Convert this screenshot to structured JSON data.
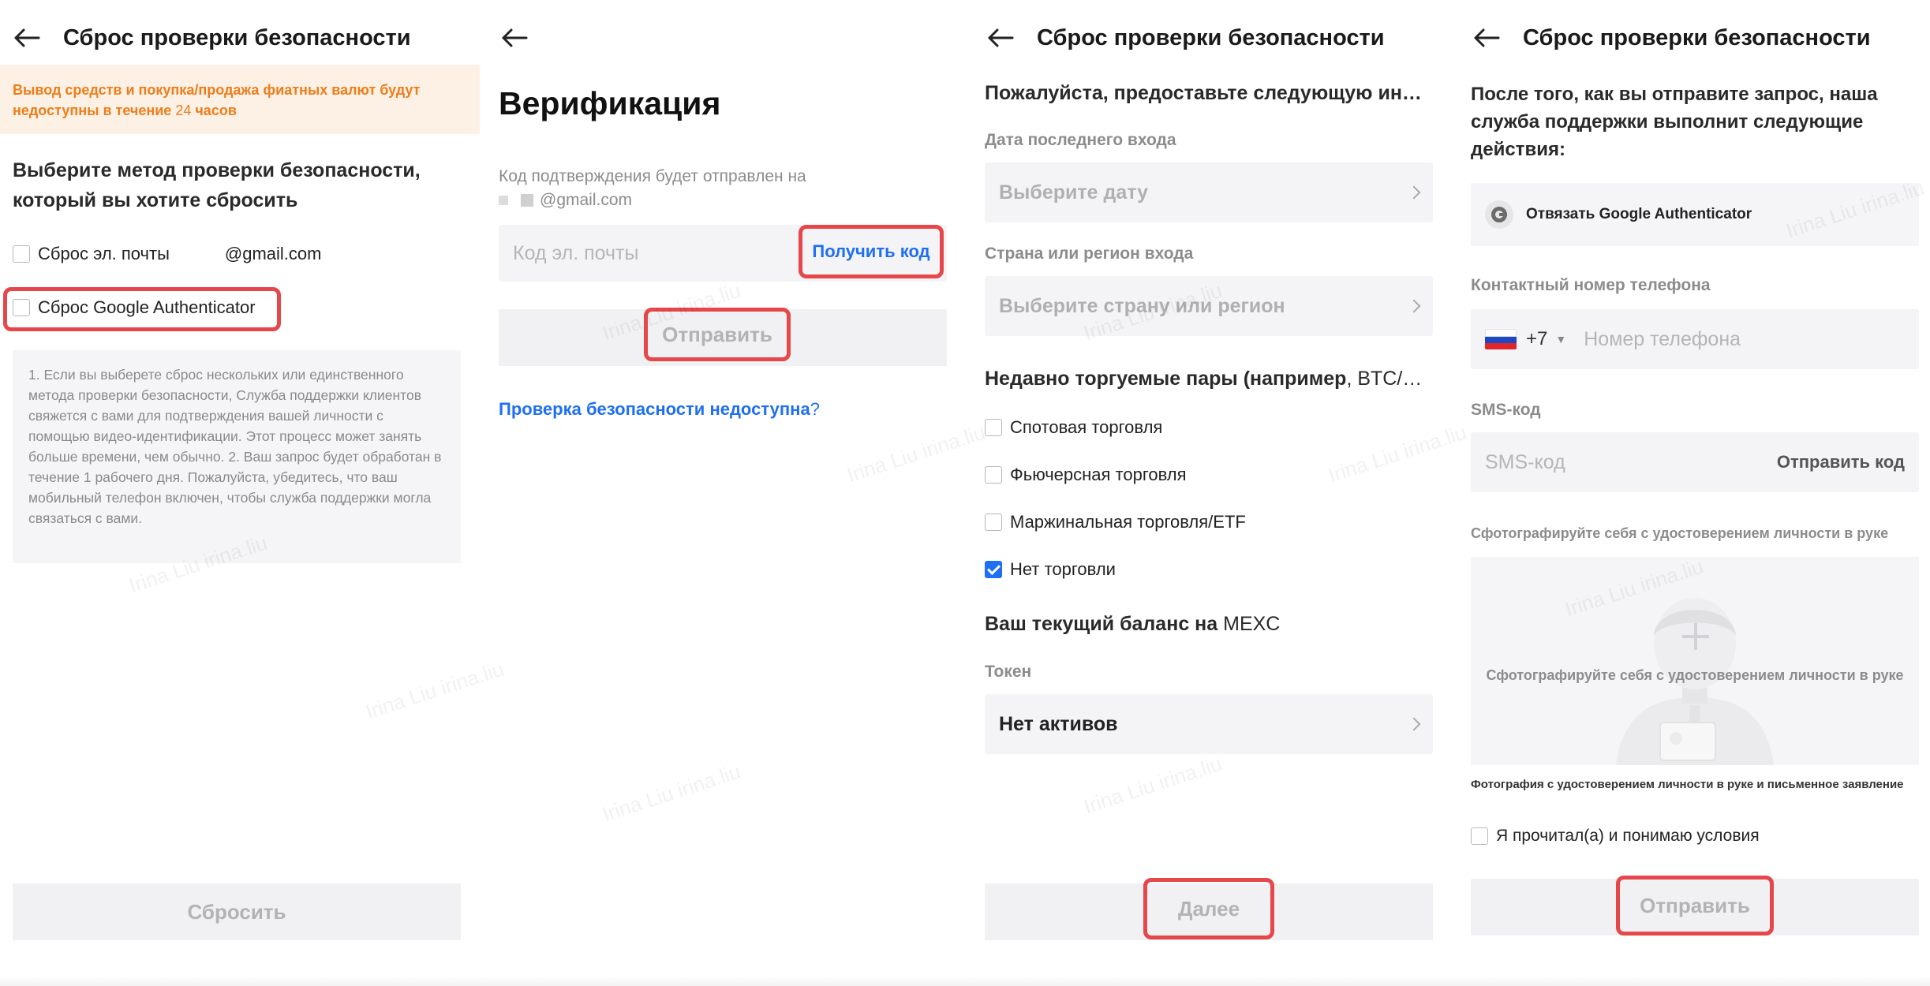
{
  "screen1": {
    "title": "Сброс проверки безопасности",
    "notice_part1": "Вывод средств и покупка/продажа фиатных валют будут недоступны в течение ",
    "notice_hours": "24",
    "notice_part2": " часов",
    "heading": "Выберите метод проверки безопасности, который вы хотите сбросить",
    "option_email": "Сброс эл. почты",
    "option_email_value": "@gmail.com",
    "option_google": "Сброс Google Authenticator",
    "info_text": "1. Если вы выберете сброс нескольких или единственного метода проверки безопасности, Служба поддержки клиентов свяжется с вами для подтверждения вашей личности с помощью видео-идентификации. Этот процесс может занять больше времени, чем обычно. 2. Ваш запрос будет обработан в течение 1 рабочего дня. Пожалуйста, убедитесь, что ваш мобильный телефон включен, чтобы служба поддержки могла связаться с вами.",
    "reset_button": "Сбросить"
  },
  "screen2": {
    "title": "Верификация",
    "sent_to_label": "Код подтверждения будет отправлен на",
    "sent_to_email": "@gmail.com",
    "code_placeholder": "Код эл. почты",
    "get_code_button": "Получить код",
    "submit_button": "Отправить",
    "unavailable_link": "Проверка безопасности недоступна",
    "unavailable_q": "?"
  },
  "screen3": {
    "title": "Сброс проверки безопасности",
    "intro": "Пожалуйста, предоставьте следующую ин…",
    "last_login_label": "Дата последнего входа",
    "date_placeholder": "Выберите дату",
    "region_label": "Страна или регион входа",
    "region_placeholder": "Выберите страну или регион",
    "pairs_heading_bold": "Недавно торгуемые пары (например",
    "pairs_heading_rest": ", BTC/…",
    "options": [
      {
        "label": "Спотовая торговля",
        "checked": false
      },
      {
        "label": "Фьючерсная торговля",
        "checked": false
      },
      {
        "label": "Маржинальная торговля/ETF",
        "checked": false
      },
      {
        "label": "Нет торговли",
        "checked": true
      }
    ],
    "balance_heading_bold": "Ваш текущий баланс на",
    "balance_heading_rest": " MEXC",
    "token_label": "Токен",
    "token_value": "Нет активов",
    "next_button": "Далее"
  },
  "screen4": {
    "title": "Сброс проверки безопасности",
    "intro": "После того, как вы отправите запрос, наша служба поддержки выполнит следующие действия:",
    "action_item": "Отвязать Google Authenticator",
    "phone_label": "Контактный номер телефона",
    "country_code": "+7",
    "phone_placeholder": "Номер телефона",
    "sms_label": "SMS-код",
    "sms_placeholder": "SMS-код",
    "send_code_button": "Отправить код",
    "photo_label": "Сфотографируйте себя с удостоверением личности в руке",
    "photo_upload_text": "Сфотографируйте себя с удостоверением личности в руке",
    "photo_caption": "Фотография с удостоверением личности в руке и письменное заявление",
    "terms": "Я прочитал(а) и понимаю условия",
    "submit_button": "Отправить"
  },
  "watermark": "Irina Liu irina.liu",
  "colors": {
    "accent_blue": "#1f6ff2",
    "warning_orange": "#ee7d19",
    "highlight_red": "#e5474b",
    "disabled_bg": "#f1f1f3"
  }
}
